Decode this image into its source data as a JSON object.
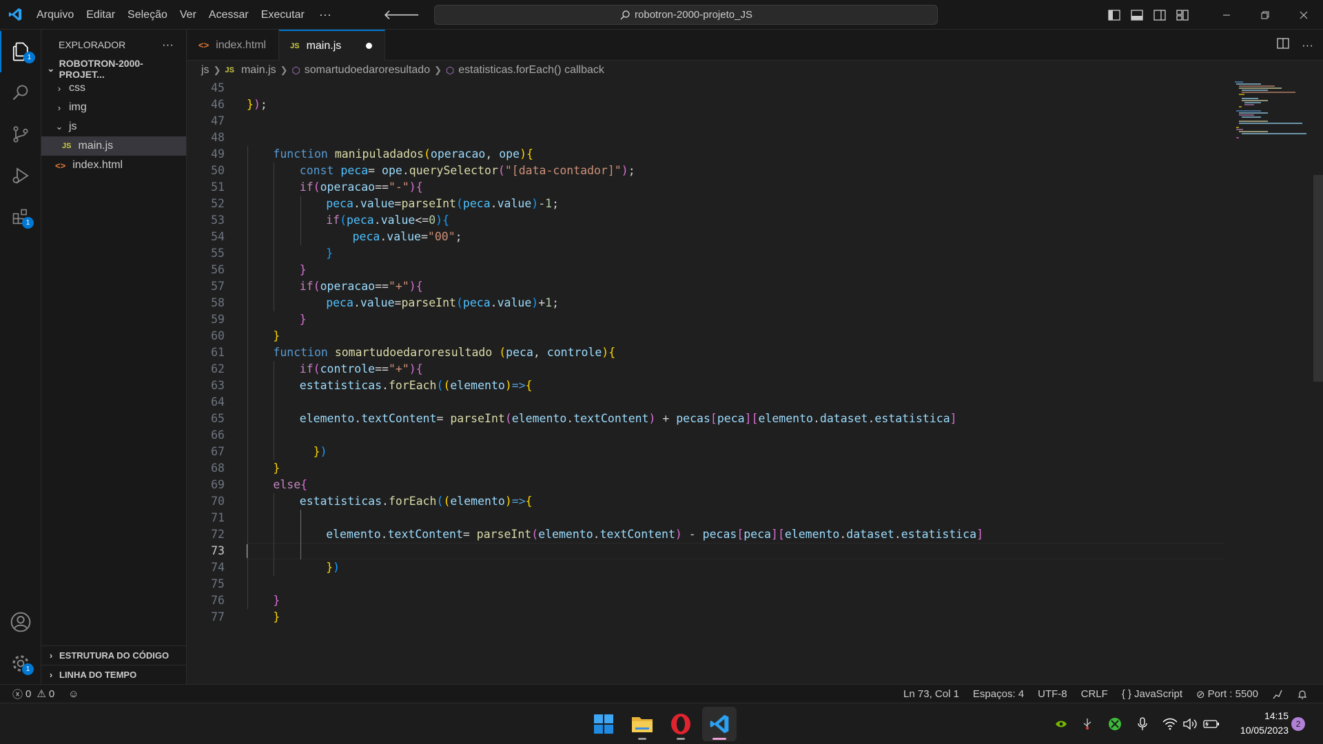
{
  "menu": [
    "Arquivo",
    "Editar",
    "Seleção",
    "Ver",
    "Acessar",
    "Executar"
  ],
  "menu_more": "···",
  "command_center": "robotron-2000-projeto_JS",
  "sidebar": {
    "title": "EXPLORADOR",
    "more": "···",
    "root": "ROBOTRON-2000-PROJET...",
    "items": [
      {
        "label": "css",
        "type": "folder",
        "expanded": false
      },
      {
        "label": "img",
        "type": "folder",
        "expanded": false
      },
      {
        "label": "js",
        "type": "folder",
        "expanded": true
      },
      {
        "label": "main.js",
        "type": "js-file",
        "selected": true
      },
      {
        "label": "index.html",
        "type": "html-file"
      }
    ],
    "sections": [
      "ESTRUTURA DO CÓDIGO",
      "LINHA DO TEMPO"
    ]
  },
  "activity_badges": {
    "explorer": "1",
    "extensions": "1",
    "settings": "1"
  },
  "tabs": [
    {
      "label": "index.html",
      "icon": "html-file-icon",
      "active": false
    },
    {
      "label": "main.js",
      "icon": "js-file-icon",
      "active": true,
      "modified": true
    }
  ],
  "file_badges": {
    "js": "JS",
    "html": "<>"
  },
  "breadcrumb": [
    "js",
    "main.js",
    "somartudoedaroresultado",
    "estatisticas.forEach() callback"
  ],
  "editor": {
    "current_line": 73,
    "lines": [
      {
        "n": "45",
        "indent": 0,
        "tokens": []
      },
      {
        "n": "46",
        "indent": 0,
        "tokens": [
          [
            "b1",
            "}"
          ],
          [
            "b2",
            ")"
          ],
          [
            "op",
            ";"
          ]
        ]
      },
      {
        "n": "47",
        "indent": 0,
        "tokens": []
      },
      {
        "n": "48",
        "indent": 0,
        "tokens": []
      },
      {
        "n": "49",
        "indent": 1,
        "tokens": [
          [
            "kw",
            "function"
          ],
          [
            "op",
            " "
          ],
          [
            "fn",
            "manipuladados"
          ],
          [
            "b1",
            "("
          ],
          [
            "var",
            "operacao"
          ],
          [
            "op",
            ", "
          ],
          [
            "var",
            "ope"
          ],
          [
            "b1",
            ")"
          ],
          [
            "b1",
            "{"
          ]
        ]
      },
      {
        "n": "50",
        "indent": 2,
        "tokens": [
          [
            "kw",
            "const"
          ],
          [
            "op",
            " "
          ],
          [
            "cst",
            "peca"
          ],
          [
            "op",
            "= "
          ],
          [
            "var",
            "ope"
          ],
          [
            "op",
            "."
          ],
          [
            "fn",
            "querySelector"
          ],
          [
            "b2",
            "("
          ],
          [
            "str",
            "\"[data-contador]\""
          ],
          [
            "b2",
            ")"
          ],
          [
            "op",
            ";"
          ]
        ]
      },
      {
        "n": "51",
        "indent": 2,
        "tokens": [
          [
            "ctl",
            "if"
          ],
          [
            "b2",
            "("
          ],
          [
            "var",
            "operacao"
          ],
          [
            "op",
            "=="
          ],
          [
            "str",
            "\"-\""
          ],
          [
            "b2",
            ")"
          ],
          [
            "b2",
            "{"
          ]
        ]
      },
      {
        "n": "52",
        "indent": 3,
        "tokens": [
          [
            "cst",
            "peca"
          ],
          [
            "op",
            "."
          ],
          [
            "var",
            "value"
          ],
          [
            "op",
            "="
          ],
          [
            "fn",
            "parseInt"
          ],
          [
            "b3",
            "("
          ],
          [
            "cst",
            "peca"
          ],
          [
            "op",
            "."
          ],
          [
            "var",
            "value"
          ],
          [
            "b3",
            ")"
          ],
          [
            "op",
            "-"
          ],
          [
            "num",
            "1"
          ],
          [
            "op",
            ";"
          ]
        ]
      },
      {
        "n": "53",
        "indent": 3,
        "tokens": [
          [
            "ctl",
            "if"
          ],
          [
            "b3",
            "("
          ],
          [
            "cst",
            "peca"
          ],
          [
            "op",
            "."
          ],
          [
            "var",
            "value"
          ],
          [
            "op",
            "<="
          ],
          [
            "num",
            "0"
          ],
          [
            "b3",
            ")"
          ],
          [
            "b3",
            "{"
          ]
        ]
      },
      {
        "n": "54",
        "indent": 4,
        "tokens": [
          [
            "cst",
            "peca"
          ],
          [
            "op",
            "."
          ],
          [
            "var",
            "value"
          ],
          [
            "op",
            "="
          ],
          [
            "str",
            "\"00\""
          ],
          [
            "op",
            ";"
          ]
        ]
      },
      {
        "n": "55",
        "indent": 3,
        "tokens": [
          [
            "b3",
            "}"
          ]
        ]
      },
      {
        "n": "56",
        "indent": 2,
        "tokens": [
          [
            "b2",
            "}"
          ]
        ]
      },
      {
        "n": "57",
        "indent": 2,
        "tokens": [
          [
            "ctl",
            "if"
          ],
          [
            "b2",
            "("
          ],
          [
            "var",
            "operacao"
          ],
          [
            "op",
            "=="
          ],
          [
            "str",
            "\"+\""
          ],
          [
            "b2",
            ")"
          ],
          [
            "b2",
            "{"
          ]
        ]
      },
      {
        "n": "58",
        "indent": 3,
        "tokens": [
          [
            "cst",
            "peca"
          ],
          [
            "op",
            "."
          ],
          [
            "var",
            "value"
          ],
          [
            "op",
            "="
          ],
          [
            "fn",
            "parseInt"
          ],
          [
            "b3",
            "("
          ],
          [
            "cst",
            "peca"
          ],
          [
            "op",
            "."
          ],
          [
            "var",
            "value"
          ],
          [
            "b3",
            ")"
          ],
          [
            "op",
            "+"
          ],
          [
            "num",
            "1"
          ],
          [
            "op",
            ";"
          ]
        ]
      },
      {
        "n": "59",
        "indent": 2,
        "tokens": [
          [
            "b2",
            "}"
          ]
        ]
      },
      {
        "n": "60",
        "indent": 1,
        "tokens": [
          [
            "b1",
            "}"
          ]
        ]
      },
      {
        "n": "61",
        "indent": 1,
        "tokens": [
          [
            "kw",
            "function"
          ],
          [
            "op",
            " "
          ],
          [
            "fn",
            "somartudoedaroresultado"
          ],
          [
            "op",
            " "
          ],
          [
            "b1",
            "("
          ],
          [
            "var",
            "peca"
          ],
          [
            "op",
            ", "
          ],
          [
            "var",
            "controle"
          ],
          [
            "b1",
            ")"
          ],
          [
            "b1",
            "{"
          ]
        ]
      },
      {
        "n": "62",
        "indent": 2,
        "tokens": [
          [
            "ctl",
            "if"
          ],
          [
            "b2",
            "("
          ],
          [
            "var",
            "controle"
          ],
          [
            "op",
            "=="
          ],
          [
            "str",
            "\"+\""
          ],
          [
            "b2",
            ")"
          ],
          [
            "b2",
            "{"
          ]
        ]
      },
      {
        "n": "63",
        "indent": 2,
        "tokens": [
          [
            "var",
            "estatisticas"
          ],
          [
            "op",
            "."
          ],
          [
            "fn",
            "forEach"
          ],
          [
            "b3",
            "("
          ],
          [
            "b1",
            "("
          ],
          [
            "var",
            "elemento"
          ],
          [
            "b1",
            ")"
          ],
          [
            "kw",
            "=>"
          ],
          [
            "b1",
            "{"
          ]
        ]
      },
      {
        "n": "64",
        "indent": 0,
        "tokens": []
      },
      {
        "n": "65",
        "indent": 2,
        "tokens": [
          [
            "var",
            "elemento"
          ],
          [
            "op",
            "."
          ],
          [
            "var",
            "textContent"
          ],
          [
            "op",
            "= "
          ],
          [
            "fn",
            "parseInt"
          ],
          [
            "b2",
            "("
          ],
          [
            "var",
            "elemento"
          ],
          [
            "op",
            "."
          ],
          [
            "var",
            "textContent"
          ],
          [
            "b2",
            ")"
          ],
          [
            "op",
            " + "
          ],
          [
            "var",
            "pecas"
          ],
          [
            "b2",
            "["
          ],
          [
            "var",
            "peca"
          ],
          [
            "b2",
            "]"
          ],
          [
            "b2",
            "["
          ],
          [
            "var",
            "elemento"
          ],
          [
            "op",
            "."
          ],
          [
            "var",
            "dataset"
          ],
          [
            "op",
            "."
          ],
          [
            "var",
            "estatistica"
          ],
          [
            "b2",
            "]"
          ]
        ]
      },
      {
        "n": "66",
        "indent": 0,
        "tokens": []
      },
      {
        "n": "67",
        "indent": 2,
        "tokens": [
          [
            "op",
            "  "
          ],
          [
            "b1",
            "}"
          ],
          [
            "b3",
            ")"
          ]
        ]
      },
      {
        "n": "68",
        "indent": 1,
        "tokens": [
          [
            "b1",
            "}"
          ]
        ]
      },
      {
        "n": "69",
        "indent": 1,
        "tokens": [
          [
            "ctl",
            "else"
          ],
          [
            "b2",
            "{"
          ]
        ]
      },
      {
        "n": "70",
        "indent": 2,
        "tokens": [
          [
            "var",
            "estatisticas"
          ],
          [
            "op",
            "."
          ],
          [
            "fn",
            "forEach"
          ],
          [
            "b3",
            "("
          ],
          [
            "b1",
            "("
          ],
          [
            "var",
            "elemento"
          ],
          [
            "b1",
            ")"
          ],
          [
            "kw",
            "=>"
          ],
          [
            "b1",
            "{"
          ]
        ]
      },
      {
        "n": "71",
        "indent": 0,
        "tokens": []
      },
      {
        "n": "72",
        "indent": 3,
        "tokens": [
          [
            "var",
            "elemento"
          ],
          [
            "op",
            "."
          ],
          [
            "var",
            "textContent"
          ],
          [
            "op",
            "= "
          ],
          [
            "fn",
            "parseInt"
          ],
          [
            "b2",
            "("
          ],
          [
            "var",
            "elemento"
          ],
          [
            "op",
            "."
          ],
          [
            "var",
            "textContent"
          ],
          [
            "b2",
            ")"
          ],
          [
            "op",
            " - "
          ],
          [
            "var",
            "pecas"
          ],
          [
            "b2",
            "["
          ],
          [
            "var",
            "peca"
          ],
          [
            "b2",
            "]"
          ],
          [
            "b2",
            "["
          ],
          [
            "var",
            "elemento"
          ],
          [
            "op",
            "."
          ],
          [
            "var",
            "dataset"
          ],
          [
            "op",
            "."
          ],
          [
            "var",
            "estatistica"
          ],
          [
            "b2",
            "]"
          ]
        ]
      },
      {
        "n": "73",
        "indent": 0,
        "tokens": []
      },
      {
        "n": "74",
        "indent": 3,
        "tokens": [
          [
            "b1",
            "}"
          ],
          [
            "b3",
            ")"
          ]
        ]
      },
      {
        "n": "75",
        "indent": 0,
        "tokens": []
      },
      {
        "n": "76",
        "indent": 1,
        "tokens": [
          [
            "b2",
            "}"
          ]
        ]
      },
      {
        "n": "77",
        "indent": 1,
        "tokens": [
          [
            "b1",
            "}"
          ]
        ]
      }
    ]
  },
  "status": {
    "errors": "0",
    "warnings": "0",
    "position": "Ln 73, Col 1",
    "spaces": "Espaços: 4",
    "encoding": "UTF-8",
    "eol": "CRLF",
    "language": "JavaScript",
    "language_icon": "{ }",
    "port": "Port : 5500"
  },
  "taskbar": {
    "time": "14:15",
    "date": "10/05/2023",
    "notifications": "2"
  },
  "colors": {
    "accent": "#0078d4",
    "keyword": "#569cd6",
    "function": "#dcdcaa",
    "string": "#ce9178"
  }
}
